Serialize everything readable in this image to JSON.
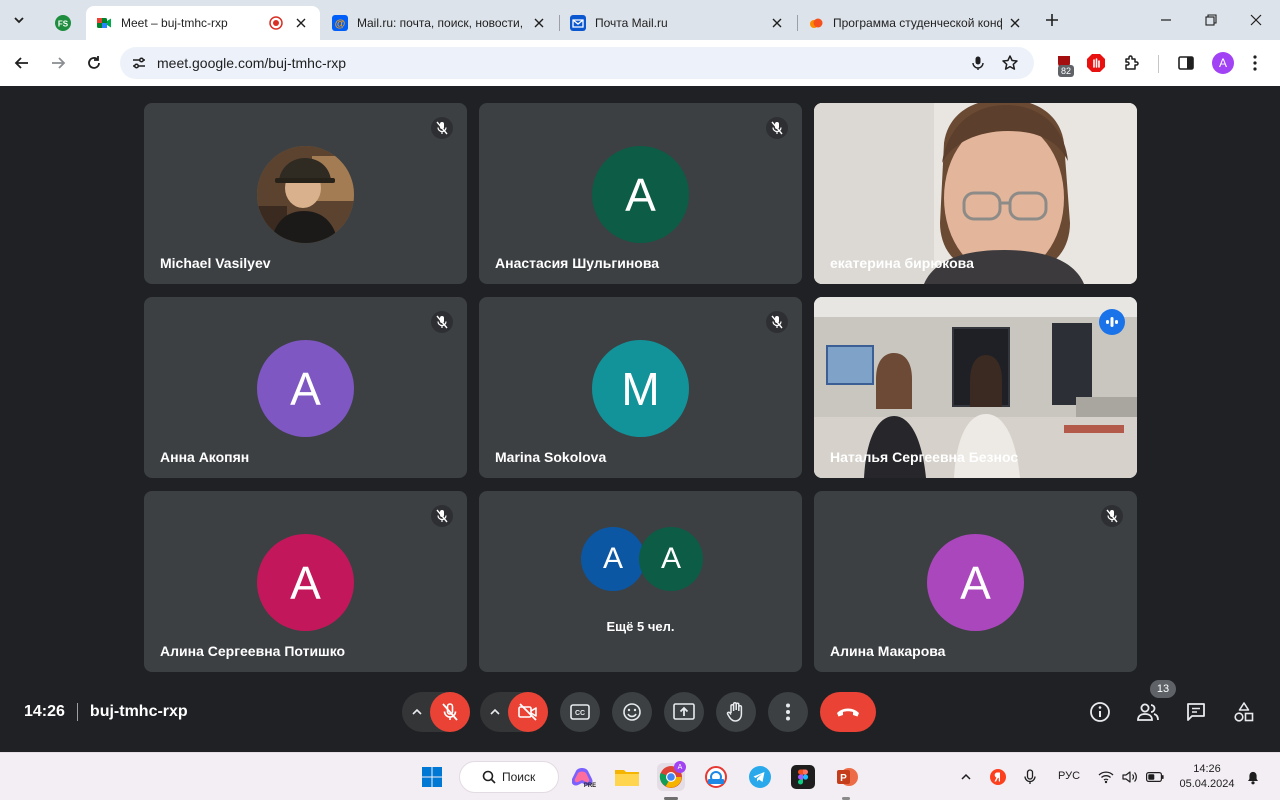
{
  "browser": {
    "tabs": [
      {
        "title": ""
      },
      {
        "title": "Meet – buj-tmhc-rxp"
      },
      {
        "title": "Mail.ru: почта, поиск, новости,"
      },
      {
        "title": "Почта Mail.ru"
      },
      {
        "title": "Программа студенческой конф"
      }
    ],
    "url": "meet.google.com/buj-tmhc-rxp",
    "extension_badge": "82",
    "profile_initial": "A"
  },
  "meet": {
    "tiles": [
      {
        "name": "Michael Vasilyev",
        "initial": "",
        "color": "#8a6a45",
        "muted": true
      },
      {
        "name": "Анастасия Шульгинова",
        "initial": "A",
        "color": "#0d5c45",
        "muted": true
      },
      {
        "name": "екатерина бирюкова",
        "initial": "",
        "color": "#d9d2cc",
        "muted": false
      },
      {
        "name": "Анна Акопян",
        "initial": "A",
        "color": "#7e57c2",
        "muted": true
      },
      {
        "name": "Marina Sokolova",
        "initial": "M",
        "color": "#12939a",
        "muted": true
      },
      {
        "name": "Наталья Сергеевна Безнос",
        "initial": "",
        "color": "#b7b4ae",
        "muted": false,
        "speaking": true
      },
      {
        "name": "Алина Сергеевна Потишко",
        "initial": "A",
        "color": "#c2185b",
        "muted": true
      },
      {
        "name": "Ещё 5 чел.",
        "initials": [
          "A",
          "A"
        ],
        "colors": [
          "#0b57a4",
          "#0d5c45"
        ]
      },
      {
        "name": "Алина Макарова",
        "initial": "A",
        "color": "#ab47bc",
        "muted": true
      }
    ],
    "time": "14:26",
    "meeting_code": "buj-tmhc-rxp",
    "participant_count": "13"
  },
  "taskbar": {
    "search_label": "Поиск",
    "language": "РУС",
    "clock_time": "14:26",
    "clock_date": "05.04.2024"
  },
  "colors": {
    "meet_bg": "#202124",
    "tile_bg": "#3c4043",
    "danger": "#ea4335",
    "speaking_outline": "#8ab4f8"
  }
}
